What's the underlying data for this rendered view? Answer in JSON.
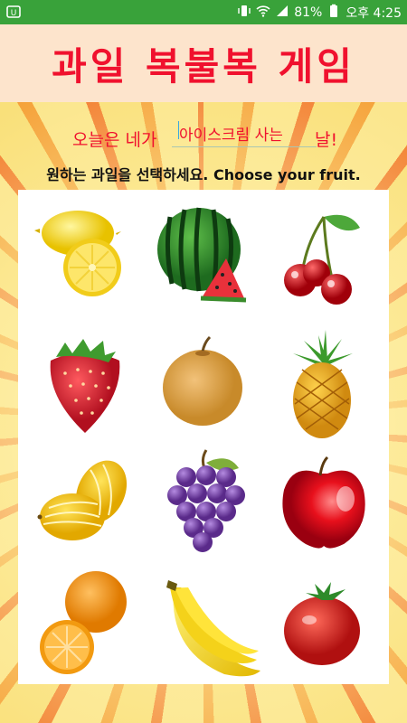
{
  "status_bar": {
    "battery": "81%",
    "time": "오후 4:25"
  },
  "header": {
    "title": "과일 복불복 게임"
  },
  "prompt": {
    "before": "오늘은 네가",
    "input_value": "아이스크림 사는",
    "after": "날!"
  },
  "instruction": "원하는 과일을 선택하세요. Choose your fruit.",
  "fruits": [
    {
      "name": "lemon"
    },
    {
      "name": "watermelon"
    },
    {
      "name": "cherry"
    },
    {
      "name": "strawberry"
    },
    {
      "name": "pear"
    },
    {
      "name": "pineapple"
    },
    {
      "name": "melon"
    },
    {
      "name": "grape"
    },
    {
      "name": "apple"
    },
    {
      "name": "orange"
    },
    {
      "name": "banana"
    },
    {
      "name": "tomato"
    }
  ],
  "colors": {
    "status_bar": "#39a23a",
    "title": "#f0112e",
    "title_bg": "#fde4cc"
  }
}
